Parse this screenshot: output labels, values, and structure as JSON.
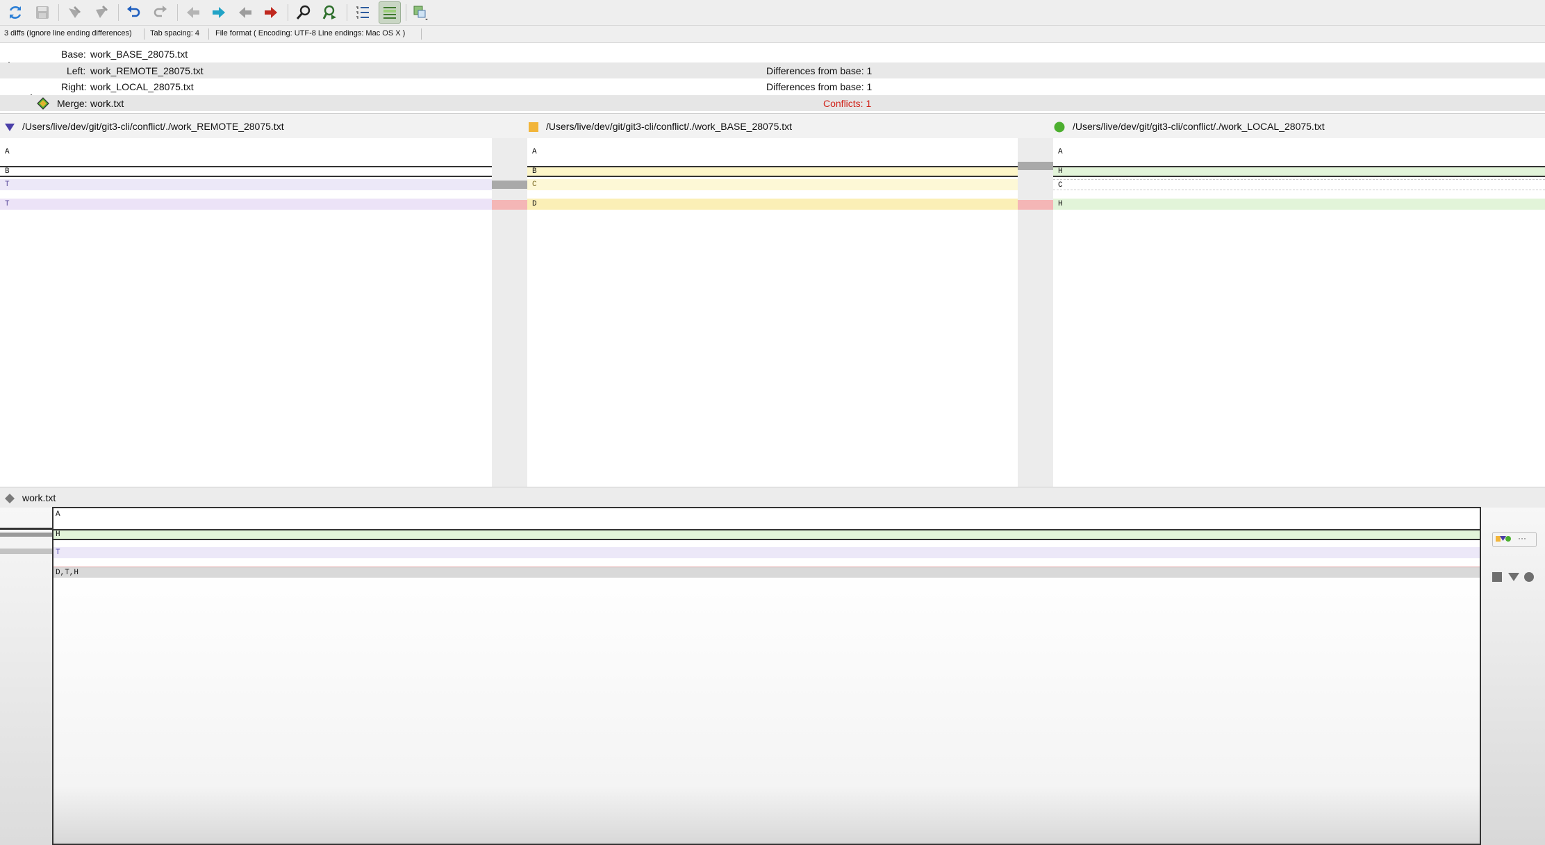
{
  "toolbar": {
    "icons": [
      "refresh-icon",
      "save-icon",
      "mark-resolved-icon",
      "mark-unresolved-icon",
      "undo-icon",
      "redo-icon",
      "prev-diff-icon",
      "next-diff-icon",
      "prev-conflict-icon",
      "next-conflict-icon",
      "find-icon",
      "find-next-icon",
      "line-numbers-icon",
      "show-diff-icon",
      "merge-mode-icon"
    ],
    "colors": {
      "refresh": "#2c7fd6",
      "undo": "#1f5fbf",
      "next_diff": "#21a3c6",
      "next_conflict": "#c0281e",
      "active_bg": "#c9d6c4"
    }
  },
  "status": {
    "diffs": "3 diffs (Ignore line ending differences)",
    "tab_spacing": "Tab spacing: 4",
    "file_format": "File format ( Encoding: UTF-8  Line endings: Mac OS X )"
  },
  "files": {
    "base_label": "Base:",
    "base_name": "work_BASE_28075.txt",
    "left_label": "Left:",
    "left_name": "work_REMOTE_28075.txt",
    "left_diff": "Differences from base: 1",
    "right_label": "Right:",
    "right_name": "work_LOCAL_28075.txt",
    "right_diff": "Differences from base: 1",
    "merge_label": "Merge:",
    "merge_name": "work.txt",
    "conflicts": "Conflicts: 1"
  },
  "panes": {
    "remote_path": "/Users/live/dev/git/git3-cli/conflict/./work_REMOTE_28075.txt",
    "base_path": "/Users/live/dev/git/git3-cli/conflict/./work_BASE_28075.txt",
    "local_path": "/Users/live/dev/git/git3-cli/conflict/./work_LOCAL_28075.txt",
    "remote_lines": [
      "A",
      "B",
      "T",
      "T"
    ],
    "base_lines": [
      "A",
      "B",
      "C",
      "D"
    ],
    "local_lines": [
      "A",
      "H",
      "C",
      "H"
    ]
  },
  "colors": {
    "remote_marker": "#4a3fa8",
    "base_marker": "#f2b53a",
    "local_marker": "#4caf2f",
    "merge_marker": "#7a7a7a",
    "changed_yellow": "#fdf6c8",
    "changed_green": "#e2f4d9",
    "changed_purple": "#ece8f8",
    "conflict_pink": "#f4b6b6",
    "conflict_text": "#d0231a"
  },
  "merge": {
    "file": "work.txt",
    "lines": [
      "A",
      "H",
      "T",
      "D,T,H"
    ]
  }
}
